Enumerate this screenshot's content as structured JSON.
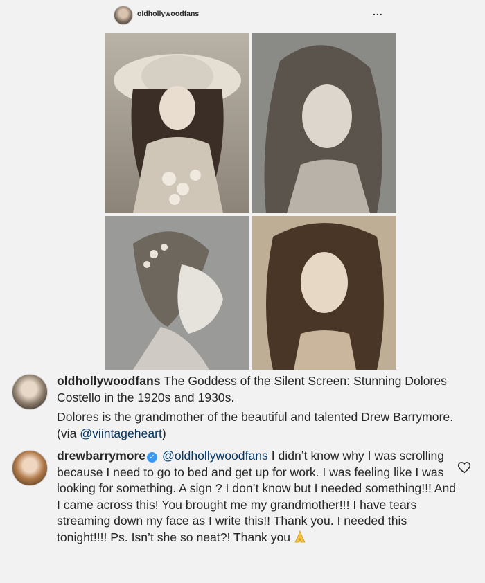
{
  "post": {
    "username": "oldhollywoodfans",
    "more_label": "..."
  },
  "caption": {
    "username": "oldhollywoodfans",
    "line1": " The Goddess of the Silent Screen: Stunning Dolores Costello in the 1920s and 1930s.",
    "line2_pre": "Dolores is the grandmother of the beautiful and talented Drew Barrymore. (via ",
    "mention": "@viintageheart",
    "line2_post": ")"
  },
  "comment": {
    "username": "drewbarrymore",
    "verified_icon": "verified-badge-icon",
    "mention": "@oldhollywoodfans",
    "text": " I didn’t know why I was scrolling because I need to go to bed and get up for work. I was feeling like I was looking for something. A sign ? I don’t know but I needed something!!! And I came across this! You brought me my grandmother!!! I have tears streaming down my face as I write this!! Thank you. I needed this tonight!!!! Ps. Isn’t she so neat?! Thank you",
    "emoji_icon": "praying-hands-icon",
    "like_icon": "heart-icon"
  },
  "colors": {
    "background": "#f2f2f2",
    "text": "#262626",
    "mention": "#00376b",
    "verified": "#3897f0"
  }
}
